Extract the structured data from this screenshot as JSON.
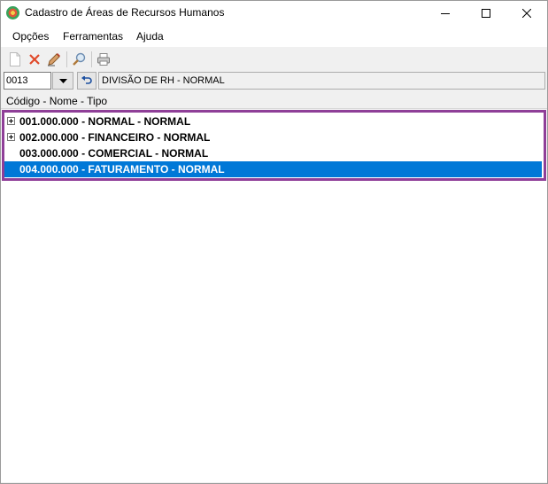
{
  "window": {
    "title": "Cadastro de Áreas de Recursos Humanos",
    "icon": "app-logo-icon"
  },
  "titlebar_buttons": [
    "minimize-icon",
    "maximize-icon",
    "close-icon"
  ],
  "menu": {
    "items": [
      "Opções",
      "Ferramentas",
      "Ajuda"
    ]
  },
  "toolbar": {
    "tools": [
      {
        "name": "new-document-icon"
      },
      {
        "name": "delete-icon"
      },
      {
        "name": "edit-icon"
      },
      {
        "name": "search-icon"
      },
      {
        "name": "print-icon"
      }
    ]
  },
  "selector": {
    "code": "0013",
    "description": "DIVISÃO DE RH - NORMAL"
  },
  "tree": {
    "header": "Código - Nome - Tipo",
    "rows": [
      {
        "label": "001.000.000 - NORMAL - NORMAL",
        "expandable": true,
        "selected": false
      },
      {
        "label": "002.000.000 - FINANCEIRO - NORMAL",
        "expandable": true,
        "selected": false
      },
      {
        "label": "003.000.000 - COMERCIAL - NORMAL",
        "expandable": false,
        "selected": false
      },
      {
        "label": "004.000.000 - FATURAMENTO - NORMAL",
        "expandable": false,
        "selected": true
      }
    ]
  },
  "colors": {
    "selection": "#0078d7",
    "highlight_border": "#8f3f98",
    "delete_icon": "#e04a2b"
  }
}
